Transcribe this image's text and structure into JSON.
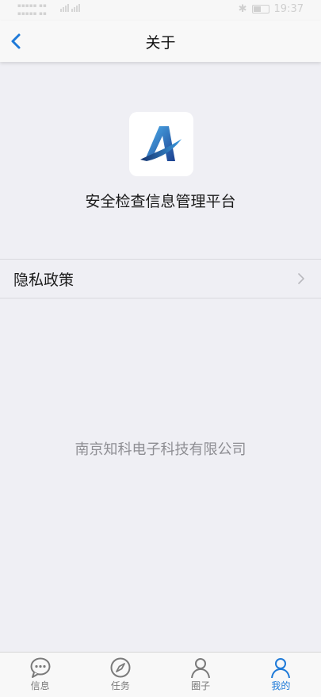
{
  "status_bar": {
    "time": "19:37"
  },
  "nav": {
    "title": "关于"
  },
  "app": {
    "name": "安全检查信息管理平台"
  },
  "menu": {
    "privacy_label": "隐私政策"
  },
  "footer": {
    "company": "南京知科电子科技有限公司"
  },
  "tabs": [
    {
      "label": "信息",
      "icon": "chat-bubble-icon",
      "active": false
    },
    {
      "label": "任务",
      "icon": "compass-icon",
      "active": false
    },
    {
      "label": "圈子",
      "icon": "person-icon",
      "active": false
    },
    {
      "label": "我的",
      "icon": "person-icon",
      "active": true
    }
  ],
  "colors": {
    "accent": "#1f7ad8",
    "background": "#efeff4",
    "tab_inactive": "#7a7a7a"
  }
}
